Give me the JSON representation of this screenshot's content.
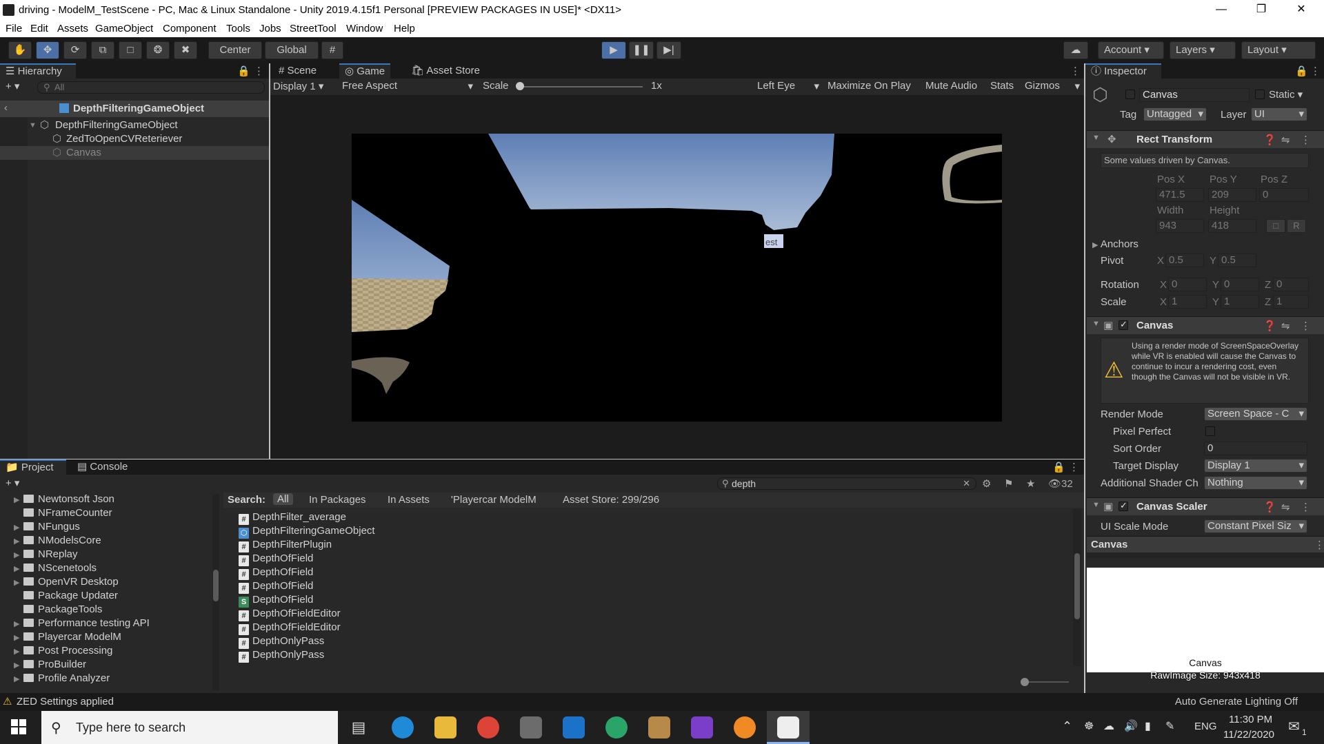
{
  "window": {
    "title": "driving - ModelM_TestScene - PC, Mac & Linux Standalone - Unity 2019.4.15f1 Personal [PREVIEW PACKAGES IN USE]* <DX11>"
  },
  "menu": [
    "File",
    "Edit",
    "Assets",
    "GameObject",
    "Component",
    "Tools",
    "Jobs",
    "StreetTool",
    "Window",
    "Help"
  ],
  "toolbar": {
    "pivot": "Center",
    "space": "Global",
    "account": "Account",
    "layers": "Layers",
    "layout": "Layout"
  },
  "hierarchy": {
    "tab": "Hierarchy",
    "search_placeholder": "All",
    "breadcrumb": "DepthFilteringGameObject",
    "items": [
      {
        "label": "DepthFilteringGameObject"
      },
      {
        "label": "ZedToOpenCVReteriever"
      },
      {
        "label": "Canvas"
      }
    ]
  },
  "game": {
    "tabs": [
      "Scene",
      "Game",
      "Asset Store"
    ],
    "display": "Display 1",
    "aspect": "Free Aspect",
    "scale_label": "Scale",
    "scale_value": "1x",
    "eye": "Left Eye",
    "maximize": "Maximize On Play",
    "mute": "Mute Audio",
    "stats": "Stats",
    "gizmos": "Gizmos",
    "overlay_text": "est"
  },
  "inspector": {
    "tab": "Inspector",
    "object_name": "Canvas",
    "static_label": "Static",
    "tag_label": "Tag",
    "tag_value": "Untagged",
    "layer_label": "Layer",
    "layer_value": "UI",
    "rect_transform": {
      "title": "Rect Transform",
      "note": "Some values driven by Canvas.",
      "posx_label": "Pos X",
      "posy_label": "Pos Y",
      "posz_label": "Pos Z",
      "posx": "471.5",
      "posy": "209",
      "posz": "0",
      "width_label": "Width",
      "height_label": "Height",
      "width": "943",
      "height": "418",
      "anchors": "Anchors",
      "pivot_label": "Pivot",
      "pivot_x": "0.5",
      "pivot_y": "0.5",
      "rotation_label": "Rotation",
      "rot_x": "0",
      "rot_y": "0",
      "rot_z": "0",
      "scale_label": "Scale",
      "scale_x": "1",
      "scale_y": "1",
      "scale_z": "1",
      "x": "X",
      "y": "Y",
      "z": "Z",
      "r": "R"
    },
    "canvas": {
      "title": "Canvas",
      "warning": "Using a render mode of ScreenSpaceOverlay while VR is enabled will cause the Canvas to continue to incur a rendering cost, even though the Canvas will not be visible in VR.",
      "render_mode_label": "Render Mode",
      "render_mode": "Screen Space - C",
      "pixel_perfect_label": "Pixel Perfect",
      "sort_order_label": "Sort Order",
      "sort_order": "0",
      "target_display_label": "Target Display",
      "target_display": "Display 1",
      "shader_label": "Additional Shader Ch",
      "shader_value": "Nothing"
    },
    "canvas_scaler": {
      "title": "Canvas Scaler",
      "ui_scale_label": "UI Scale Mode",
      "ui_scale_value": "Constant Pixel Siz"
    },
    "preview": {
      "header": "Canvas",
      "label": "Canvas",
      "size": "RawImage Size: 943x418"
    }
  },
  "project": {
    "tabs": [
      "Project",
      "Console"
    ],
    "search_value": "depth",
    "hidden_count": "32",
    "filters": {
      "search": "Search:",
      "all": "All",
      "packages": "In Packages",
      "assets": "In Assets",
      "folder": "'Playercar ModelM",
      "store": "Asset Store: 299/296"
    },
    "folders": [
      "Newtonsoft Json",
      "NFrameCounter",
      "NFungus",
      "NModelsCore",
      "NReplay",
      "NScenetools",
      "OpenVR Desktop",
      "Package Updater",
      "PackageTools",
      "Performance testing API",
      "Playercar ModelM",
      "Post Processing",
      "ProBuilder",
      "Profile Analyzer"
    ],
    "assets": [
      {
        "name": "DepthFilter_average",
        "icon": "#"
      },
      {
        "name": "DepthFilteringGameObject",
        "icon": "cube"
      },
      {
        "name": "DepthFilterPlugin",
        "icon": "#"
      },
      {
        "name": "DepthOfField",
        "icon": "#"
      },
      {
        "name": "DepthOfField",
        "icon": "#"
      },
      {
        "name": "DepthOfField",
        "icon": "#"
      },
      {
        "name": "DepthOfField",
        "icon": "S"
      },
      {
        "name": "DepthOfFieldEditor",
        "icon": "#"
      },
      {
        "name": "DepthOfFieldEditor",
        "icon": "#"
      },
      {
        "name": "DepthOnlyPass",
        "icon": "#"
      },
      {
        "name": "DepthOnlyPass",
        "icon": "#"
      }
    ]
  },
  "status": {
    "message": "ZED Settings applied",
    "lighting": "Auto Generate Lighting Off"
  },
  "taskbar": {
    "search_placeholder": "Type here to search",
    "lang": "ENG",
    "time": "11:30 PM",
    "date": "11/22/2020",
    "notifications": "1"
  }
}
